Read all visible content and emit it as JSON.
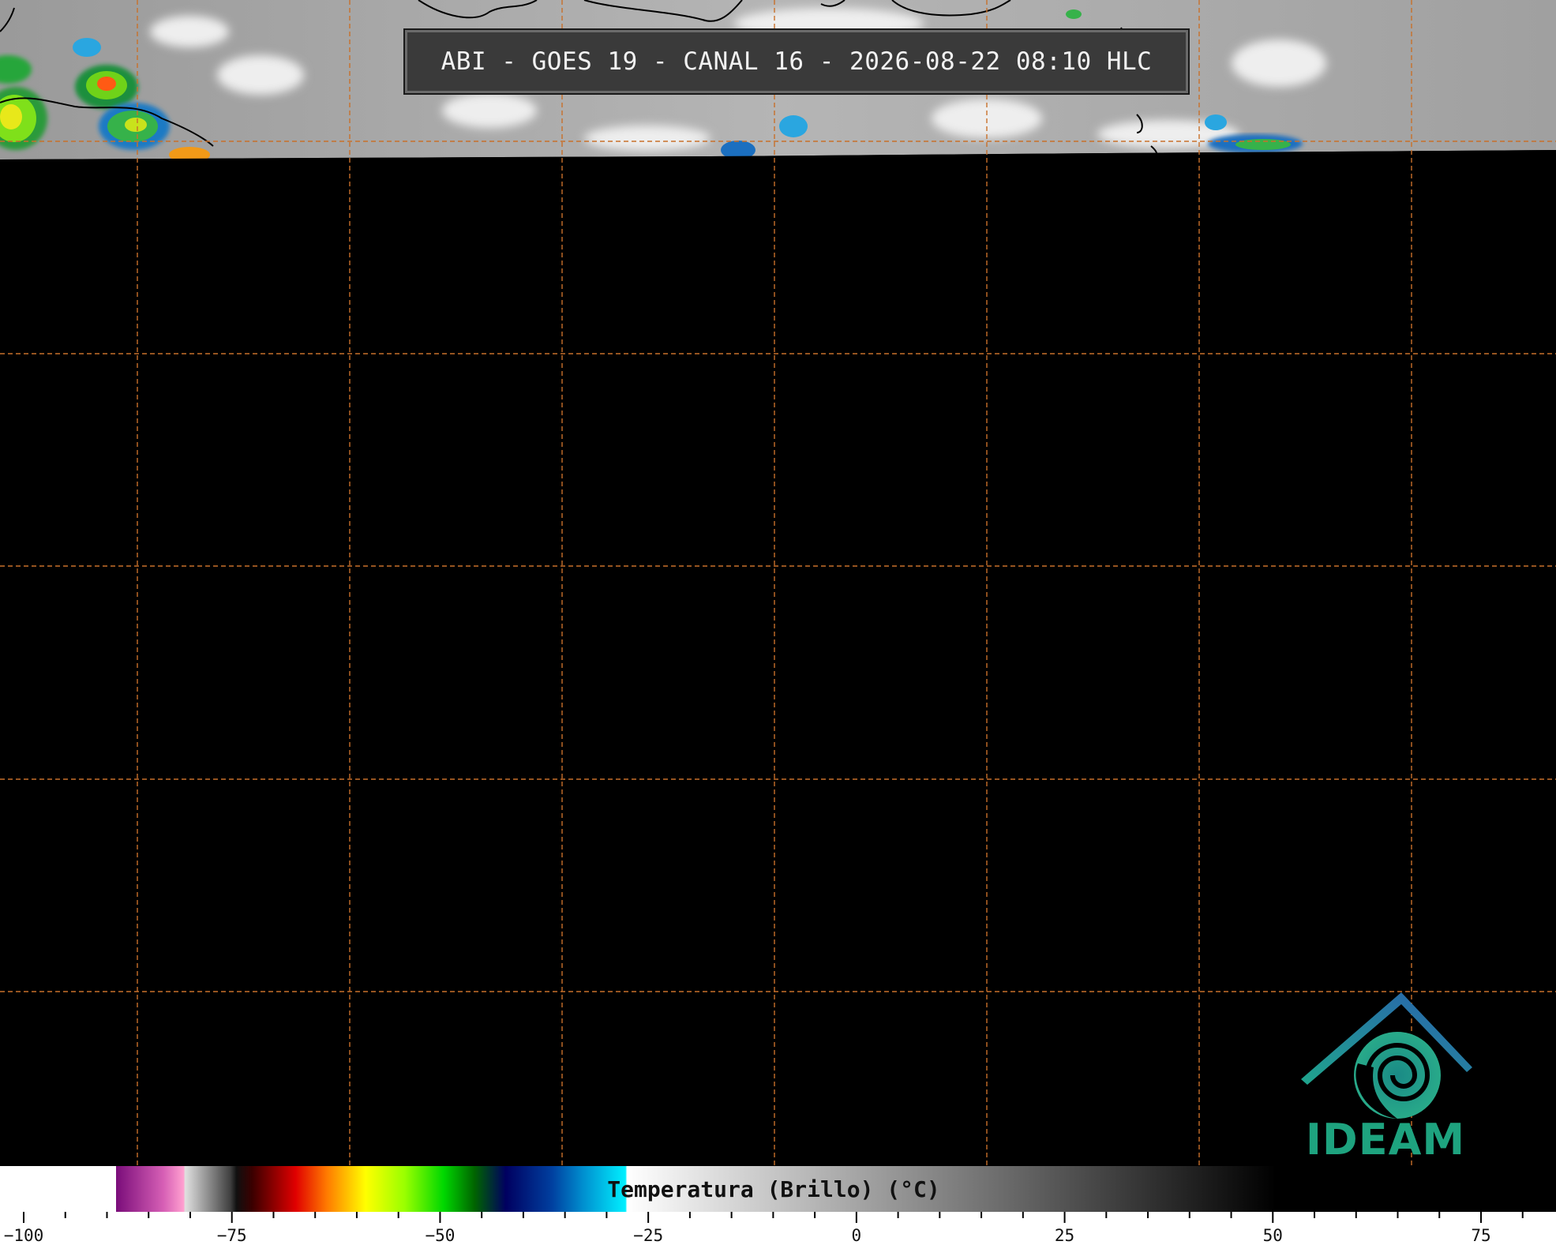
{
  "title": "ABI - GOES 19 - CANAL 16 - 2026-08-22 08:10 HLC",
  "logo": {
    "text": "IDEAM",
    "color": "#1ea37f"
  },
  "colorbar": {
    "label": "Temperatura (Brillo) (°C)",
    "min": -100,
    "max": 85,
    "ticks": [
      "−100",
      "−75",
      "−50",
      "−25",
      "0",
      "25",
      "50",
      "75"
    ],
    "tick_values": [
      -100,
      -75,
      -50,
      -25,
      0,
      25,
      50,
      75
    ]
  },
  "colors": {
    "grid": "#c8702a",
    "coastline": "#000000",
    "background": "#000000",
    "title_box": "#3a3a3a"
  }
}
